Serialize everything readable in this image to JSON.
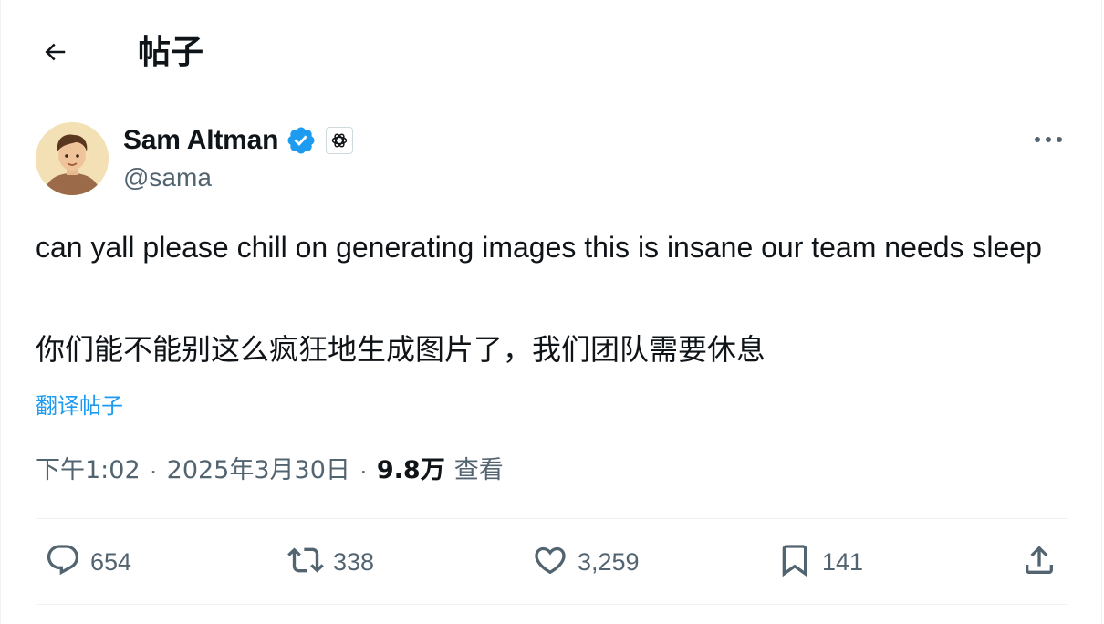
{
  "header": {
    "back_icon": "arrow-left-icon",
    "title": "帖子"
  },
  "author": {
    "display_name": "Sam Altman",
    "handle": "@sama",
    "verified_icon": "verified-badge-icon",
    "verified_color": "#1d9bf0",
    "affiliation_icon": "openai-logo-icon"
  },
  "tweet": {
    "text": "can yall please chill on generating images this is insane our team needs sleep",
    "translation": "你们能不能别这么疯狂地生成图片了，我们团队需要休息",
    "translate_link": "翻译帖子",
    "time": "下午1:02",
    "date": "2025年3月30日",
    "separator": "·",
    "views_count": "9.8万",
    "views_label": "查看"
  },
  "actions": {
    "replies": "654",
    "retweets": "338",
    "likes": "3,259",
    "bookmarks": "141"
  },
  "colors": {
    "accent": "#1d9bf0",
    "text": "#0f1419",
    "muted": "#536471",
    "border": "#eff3f4"
  }
}
